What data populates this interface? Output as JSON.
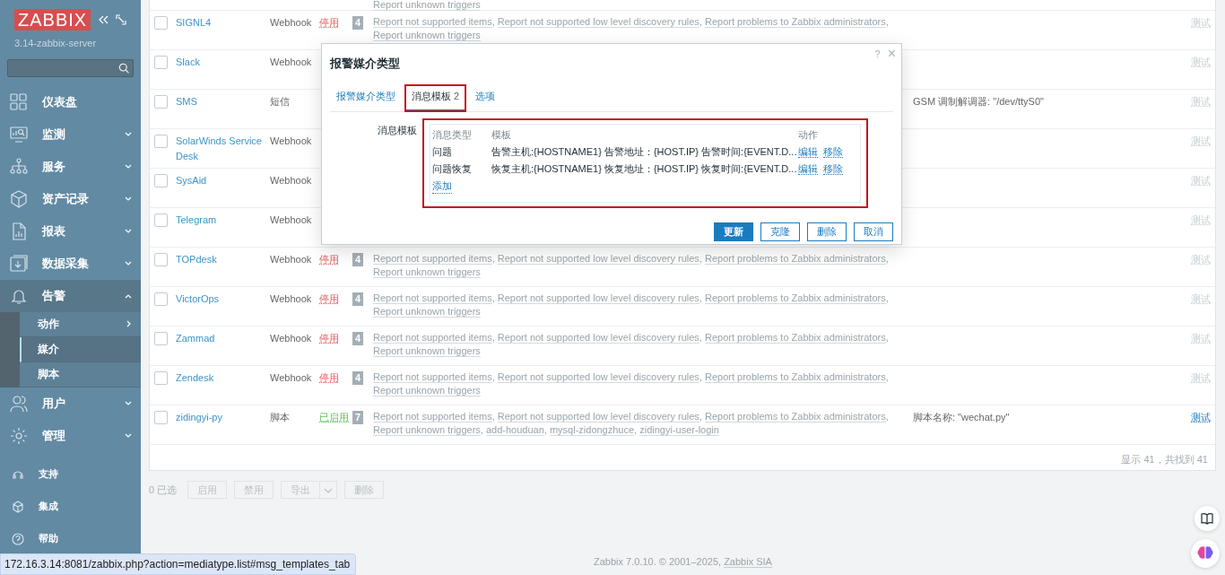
{
  "sidebar": {
    "logo": "ZABBIX",
    "server": "3.14-zabbix-server",
    "menu": [
      {
        "label": "仪表盘",
        "expandable": false,
        "expanded": false
      },
      {
        "label": "监测",
        "expandable": true,
        "expanded": false
      },
      {
        "label": "服务",
        "expandable": true,
        "expanded": false
      },
      {
        "label": "资产记录",
        "expandable": true,
        "expanded": false
      },
      {
        "label": "报表",
        "expandable": true,
        "expanded": false
      },
      {
        "label": "数据采集",
        "expandable": true,
        "expanded": false
      },
      {
        "label": "告警",
        "expandable": true,
        "expanded": true,
        "children": [
          {
            "label": "动作",
            "has_submenu": true,
            "selected": false
          },
          {
            "label": "媒介",
            "has_submenu": false,
            "selected": true
          },
          {
            "label": "脚本",
            "has_submenu": false,
            "selected": false
          }
        ]
      },
      {
        "label": "用户",
        "expandable": true,
        "expanded": false
      },
      {
        "label": "管理",
        "expandable": true,
        "expanded": false
      }
    ],
    "bottom": [
      {
        "label": "支持"
      },
      {
        "label": "集成"
      },
      {
        "label": "帮助"
      }
    ]
  },
  "table": {
    "rows": [
      {
        "actions": [
          "Report unknown triggers"
        ]
      },
      {
        "name": "SIGNL4",
        "checked": false,
        "type": "Webhook",
        "status": {
          "label": "停用",
          "enabled": false
        },
        "count": "4",
        "actions": [
          "Report not supported items",
          "Report not supported low level discovery rules",
          "Report problems to Zabbix administrators",
          "Report unknown triggers"
        ],
        "test": {
          "label": "测试",
          "enabled": false
        }
      },
      {
        "name": "Slack",
        "checked": false,
        "type": "Webhook",
        "test": {
          "label": "测试",
          "enabled": false
        }
      },
      {
        "name": "SMS",
        "checked": false,
        "type": "短信",
        "description": "GSM 调制解调器: \"/dev/ttyS0\"",
        "test": {
          "label": "测试",
          "enabled": false
        }
      },
      {
        "name": "SolarWinds Service Desk",
        "checked": false,
        "type": "Webhook",
        "test": {
          "label": "测试",
          "enabled": false
        }
      },
      {
        "name": "SysAid",
        "checked": false,
        "type": "Webhook",
        "test": {
          "label": "测试",
          "enabled": false
        }
      },
      {
        "name": "Telegram",
        "checked": false,
        "type": "Webhook",
        "test": {
          "label": "测试",
          "enabled": false
        }
      },
      {
        "name": "TOPdesk",
        "checked": false,
        "type": "Webhook",
        "status": {
          "label": "停用",
          "enabled": false
        },
        "count": "4",
        "actions": [
          "Report not supported items",
          "Report not supported low level discovery rules",
          "Report problems to Zabbix administrators",
          "Report unknown triggers"
        ],
        "test": {
          "label": "测试",
          "enabled": false
        }
      },
      {
        "name": "VictorOps",
        "checked": false,
        "type": "Webhook",
        "status": {
          "label": "停用",
          "enabled": false
        },
        "count": "4",
        "actions": [
          "Report not supported items",
          "Report not supported low level discovery rules",
          "Report problems to Zabbix administrators",
          "Report unknown triggers"
        ],
        "test": {
          "label": "测试",
          "enabled": false
        }
      },
      {
        "name": "Zammad",
        "checked": false,
        "type": "Webhook",
        "status": {
          "label": "停用",
          "enabled": false
        },
        "count": "4",
        "actions": [
          "Report not supported items",
          "Report not supported low level discovery rules",
          "Report problems to Zabbix administrators",
          "Report unknown triggers"
        ],
        "test": {
          "label": "测试",
          "enabled": false
        }
      },
      {
        "name": "Zendesk",
        "checked": false,
        "type": "Webhook",
        "status": {
          "label": "停用",
          "enabled": false
        },
        "count": "4",
        "actions": [
          "Report not supported items",
          "Report not supported low level discovery rules",
          "Report problems to Zabbix administrators",
          "Report unknown triggers"
        ],
        "test": {
          "label": "测试",
          "enabled": false
        }
      },
      {
        "name": "zidingyi-py",
        "checked": false,
        "type": "脚本",
        "status": {
          "label": "已启用",
          "enabled": true
        },
        "count": "7",
        "actions": [
          "Report not supported items",
          "Report not supported low level discovery rules",
          "Report problems to Zabbix administrators",
          "Report unknown triggers",
          "add-houduan",
          "mysql-zidongzhuce",
          "zidingyi-user-login"
        ],
        "description": "脚本名称: \"wechat.py\"",
        "test": {
          "label": "测试",
          "enabled": true
        }
      }
    ],
    "separator": ",",
    "summary": "显示 41，共找到 41"
  },
  "mass_actions": {
    "selected": "0 已选",
    "buttons": [
      {
        "label": "启用",
        "disabled": true,
        "dropdown": false
      },
      {
        "label": "禁用",
        "disabled": true,
        "dropdown": false
      },
      {
        "label": "导出",
        "disabled": true,
        "dropdown": true
      },
      {
        "label": "删除",
        "disabled": true,
        "dropdown": false
      }
    ]
  },
  "footer": {
    "text": "Zabbix 7.0.10. © 2001–2025, ",
    "link": "Zabbix SIA"
  },
  "status_url": "172.16.3.14:8081/zabbix.php?action=mediatype.list#msg_templates_tab",
  "modal": {
    "title": "报警媒介类型",
    "help": "?",
    "close": "×",
    "tabs": [
      {
        "label": "报警媒介类型",
        "selected": false,
        "highlighted": false
      },
      {
        "label": "消息模板",
        "count": "2",
        "selected": true,
        "highlighted": true
      },
      {
        "label": "选项",
        "selected": false,
        "highlighted": false
      }
    ],
    "field_label": "消息模板",
    "templates": {
      "highlighted": true,
      "columns": [
        "消息类型",
        "模板",
        "动作"
      ],
      "rows": [
        {
          "type": "问题",
          "template": "告警主机:{HOSTNAME1} 告警地址：{HOST.IP} 告警时间:{EVENT.D...",
          "actions": [
            "编辑",
            "移除"
          ]
        },
        {
          "type": "问题恢复",
          "template": "恢复主机:{HOSTNAME1} 恢复地址：{HOST.IP} 恢复时间:{EVENT.D...",
          "actions": [
            "编辑",
            "移除"
          ]
        }
      ],
      "add": "添加"
    },
    "buttons": [
      {
        "label": "更新",
        "primary": true
      },
      {
        "label": "克隆",
        "primary": false
      },
      {
        "label": "删除",
        "primary": false
      },
      {
        "label": "取消",
        "primary": false
      }
    ]
  }
}
